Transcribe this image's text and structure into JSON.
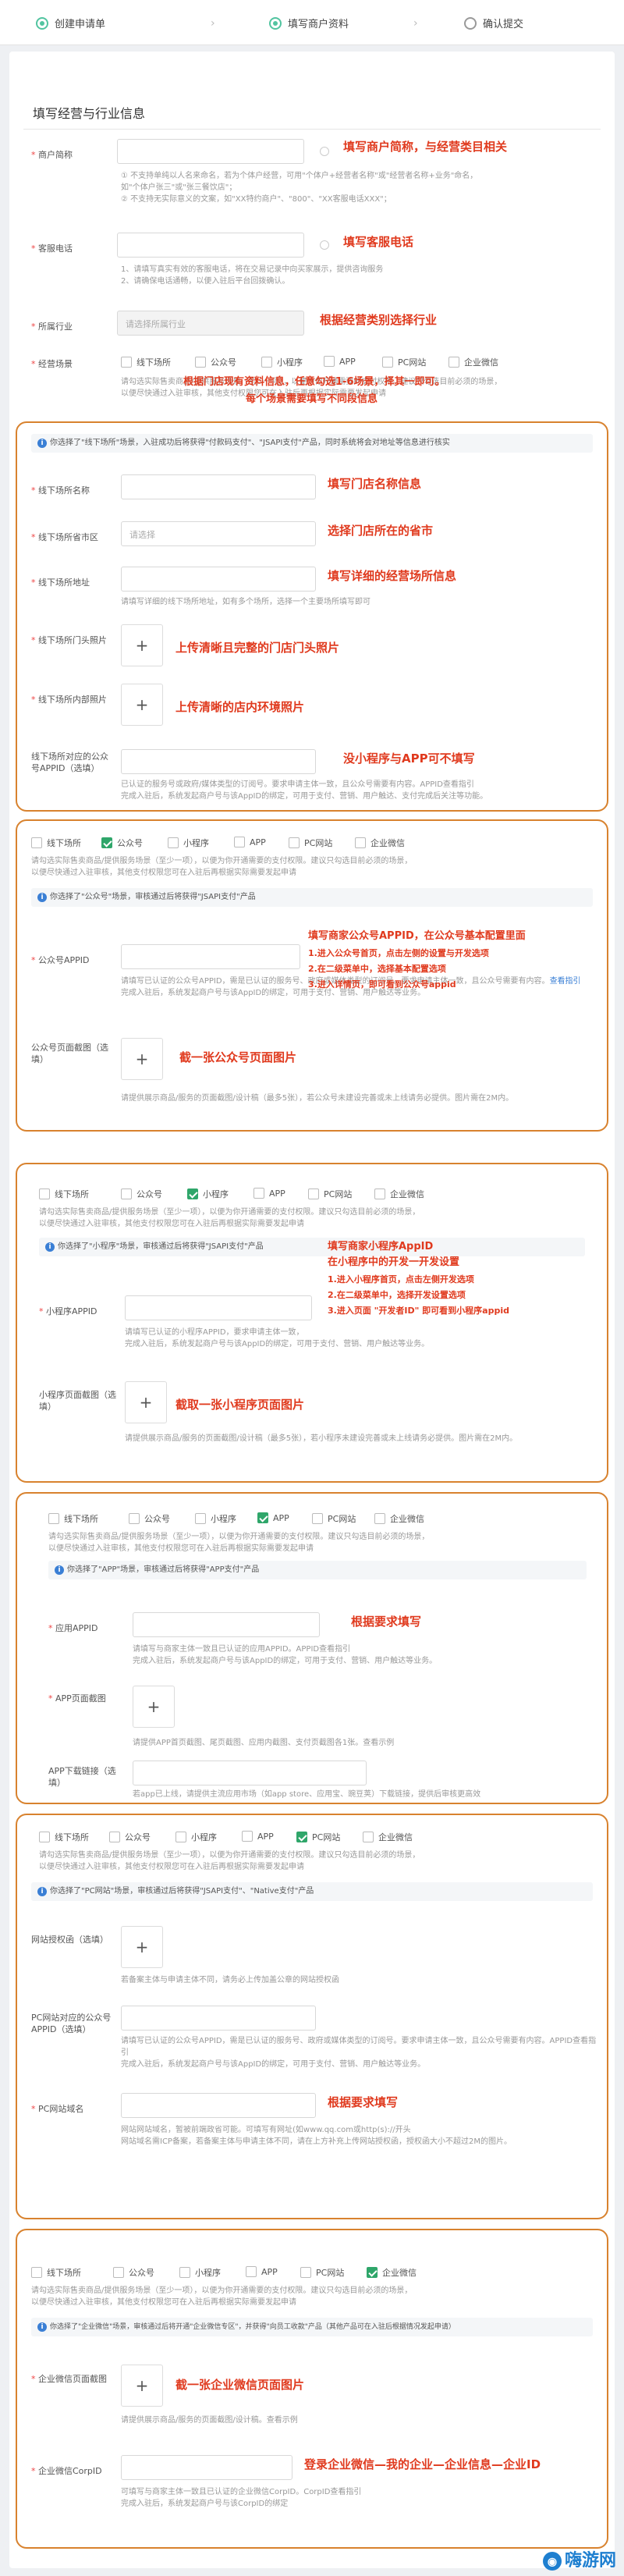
{
  "steps": [
    {
      "label": "创建申请单"
    },
    {
      "label": "填写商户资料"
    },
    {
      "label": "确认提交"
    }
  ],
  "section_title": "填写经营与行业信息",
  "merchant_short_name": {
    "label": "商户简称",
    "annotation": "填写商户简称，与经营类目相关",
    "hint1": "① 不支持单纯以人名来命名，若为个体户经营，可用\"个体户+经营者名称\"或\"经营者名称+业务\"命名，",
    "hint2": "如\"个体户张三\"或\"张三餐饮店\"；",
    "hint3": "② 不支持无实际意义的文案，如\"XX特约商户\"、\"800\"、\"XX客服电话XXX\"；"
  },
  "service_phone": {
    "label": "客服电话",
    "annotation": "填写客服电话",
    "hint1": "1、请填写真实有效的客服电话，将在交易记录中向买家展示，提供咨询服务",
    "hint2": "2、请确保电话通畅，以便入驻后平台回拨确认。"
  },
  "industry": {
    "label": "所属行业",
    "placeholder": "请选择所属行业",
    "annotation": "根据经营类别选择行业"
  },
  "business_scene": {
    "label": "经营场景",
    "options": [
      "线下场所",
      "公众号",
      "小程序",
      "APP",
      "PC网站",
      "企业微信"
    ],
    "hint1": "请勾选实际售卖商品/提供服务场景（至少一项），以便为你开通需要的支付权限。建议只勾选目前必须的场景，",
    "hint2": "以便尽快通过入驻审核，其他支付权限您可在入驻后再根据实际需要发起申请",
    "annotation1": "根据门店现有资料信息，任意勾选1-6场景，择其一即可。",
    "annotation2": "每个场景需要填写不同段信息"
  },
  "offline": {
    "info": "你选择了\"线下场所\"场景，入驻成功后将获得\"付款码支付\"、\"JSAPI支付\"产品，同时系统将会对地址等信息进行核实",
    "name_label": "线下场所名称",
    "name_annotation": "填写门店名称信息",
    "region_label": "线下场所省市区",
    "region_placeholder": "请选择",
    "region_annotation": "选择门店所在的省市",
    "address_label": "线下场所地址",
    "address_hint": "请填写详细的线下场所地址，如有多个场所，选择一个主要场所填写即可",
    "address_annotation": "填写详细的经营场所信息",
    "door_label": "线下场所门头照片",
    "door_annotation": "上传清晰且完整的门店门头照片",
    "inner_label": "线下场所内部照片",
    "inner_annotation": "上传清晰的店内环境照片",
    "appid_label": "线下场所对应的公众号APPID（选填）",
    "appid_annotation": "没小程序与APP可不填写",
    "appid_hint1": "已认证的服务号或政府/媒体类型的订阅号。要求申请主体一致，且公众号需要有内容。APPID查看指引",
    "appid_hint2": "完成入驻后，系统发起商户号与该AppID的绑定，可用于支付、营销、用户触达、支付完成后关注等功能。"
  },
  "mp": {
    "options": [
      "线下场所",
      "公众号",
      "小程序",
      "APP",
      "PC网站",
      "企业微信"
    ],
    "hint1": "请勾选实际售卖商品/提供服务场景（至少一项），以便为你开通需要的支付权限。建议只勾选目前必须的场景，",
    "hint2": "以便尽快通过入驻审核，其他支付权限您可在入驻后再根据实际需要发起申请",
    "info": "你选择了\"公众号\"场景，审核通过后将获得\"JSAPI支付\"产品",
    "appid_label": "公众号APPID",
    "appid_hint1": "请填写已认证的公众号APPID，需是已认证的服务号、政府或媒体类型的订阅号。要求申请主体一致，且公众号需要有内容。",
    "appid_hint_link": "查看指引",
    "appid_hint2": "完成入驻后，系统发起商户号与该AppID的绑定，可用于支付、营销、用户触达等业务。",
    "annotation_title": "填写商家公众号APPID，在公众号基本配置里面",
    "annotation_1": "1.进入公众号首页，点击左侧的设置与开发选项",
    "annotation_2": "2.在二级菜单中，选择基本配置选项",
    "annotation_3": "3.进入详情页，即可看到公众号appid",
    "screenshot_label": "公众号页面截图（选填）",
    "screenshot_annotation": "截一张公众号页面图片",
    "screenshot_hint": "请提供展示商品/服务的页面截图/设计稿（最多5张），若公众号未建设完善或未上线请务必提供。图片需在2M内。"
  },
  "mini": {
    "options": [
      "线下场所",
      "公众号",
      "小程序",
      "APP",
      "PC网站",
      "企业微信"
    ],
    "hint1": "请勾选实际售卖商品/提供服务场景（至少一项），以便为你开通需要的支付权限。建议只勾选目前必须的场景，",
    "hint2": "以便尽快通过入驻审核，其他支付权限您可在入驻后再根据实际需要发起申请",
    "info": "你选择了\"小程序\"场景，审核通过后将获得\"JSAPI支付\"产品",
    "appid_label": "小程序APPID",
    "appid_hint1": "请填写已认证的小程序APPID，要求申请主体一致，",
    "appid_hint2": "完成入驻后，系统发起商户号与该AppID的绑定，可用于支付、营销、用户触达等业务。",
    "annotation_title": "填写商家小程序AppID",
    "annotation_sub": "在小程序中的开发一开发设置",
    "annotation_1": "1.进入小程序首页，点击左侧开发选项",
    "annotation_2": "2.在二级菜单中，选择开发设置选项",
    "annotation_3": "3.进入页面 \"开发者ID\" 即可看到小程序appid",
    "screenshot_label": "小程序页面截图（选填）",
    "screenshot_annotation": "截取一张小程序页面图片",
    "screenshot_hint": "请提供展示商品/服务的页面截图/设计稿（最多5张），若小程序未建设完善或未上线请务必提供。图片需在2M内。"
  },
  "app": {
    "options": [
      "线下场所",
      "公众号",
      "小程序",
      "APP",
      "PC网站",
      "企业微信"
    ],
    "hint1": "请勾选实际售卖商品/提供服务场景（至少一项），以便为你开通需要的支付权限。建议只勾选目前必须的场景，",
    "hint2": "以便尽快通过入驻审核，其他支付权限您可在入驻后再根据实际需要发起申请",
    "info": "你选择了\"APP\"场景，审核通过后将获得\"APP支付\"产品",
    "appid_label": "应用APPID",
    "appid_annotation": "根据要求填写",
    "appid_hint1": "请填写与商家主体一致且已认证的应用APPID。APPID查看指引",
    "appid_hint2": "完成入驻后，系统发起商户号与该AppID的绑定，可用于支付、营销、用户触达等业务。",
    "screenshot_label": "APP页面截图",
    "screenshot_hint": "请提供APP首页截图、尾页截图、应用内截图、支付页截图各1张。查看示例",
    "download_label": "APP下载链接（选填）",
    "download_hint": "若app已上线，请提供主流应用市场（如app store、应用宝、豌豆荚）下载链接，提供后审核更高效"
  },
  "pc": {
    "options": [
      "线下场所",
      "公众号",
      "小程序",
      "APP",
      "PC网站",
      "企业微信"
    ],
    "hint1": "请勾选实际售卖商品/提供服务场景（至少一项），以便为你开通需要的支付权限。建议只勾选目前必须的场景，",
    "hint2": "以便尽快通过入驻审核，其他支付权限您可在入驻后再根据实际需要发起申请",
    "info": "你选择了\"PC网站\"场景，审核通过后将获得\"JSAPI支付\"、\"Native支付\"产品",
    "license_label": "网站授权函（选填）",
    "license_hint": "若备案主体与申请主体不同，请务必上传加盖公章的网站授权函",
    "appid_label": "PC网站对应的公众号APPID（选填）",
    "appid_hint1": "请填写已认证的公众号APPID，需是已认证的服务号、政府或媒体类型的订阅号。要求申请主体一致，且公众号需要有内容。APPID查看指引",
    "appid_hint2": "完成入驻后，系统发起商户号与该AppID的绑定，可用于支付、营销、用户触达等业务。",
    "domain_label": "PC网站域名",
    "domain_annotation": "根据要求填写",
    "domain_hint1": "网站网站域名，暂被前端政省可能。可填写有网址(如www.qq.com或http(s)://开头",
    "domain_hint2": "网站域名需ICP备案，若备案主体与申请主体不同，请在上方补充上传网站授权函，授权函大小不超过2M的图片。"
  },
  "wework": {
    "options": [
      "线下场所",
      "公众号",
      "小程序",
      "APP",
      "PC网站",
      "企业微信"
    ],
    "hint1": "请勾选实际售卖商品/提供服务场景（至少一项），以便为你开通需要的支付权限。建议只勾选目前必须的场景，",
    "hint2": "以便尽快通过入驻审核，其他支付权限您可在入驻后再根据实际需要发起申请",
    "info": "你选择了\"企业微信\"场景，审核通过后将开通\"企业微信专区\"，并获得\"向员工收款\"产品（其他产品可在入驻后根据情况发起申请）",
    "screenshot_label": "企业微信页面截图",
    "screenshot_annotation": "截一张企业微信页面图片",
    "screenshot_hint": "请提供展示商品/服务的页面截图/设计稿。查看示例",
    "corpid_label": "企业微信CorpID",
    "corpid_annotation": "登录企业微信—我的企业—企业信息—企业ID",
    "corpid_hint1": "可填写与商家主体一致且已认证的企业微信CorpID。CorpID查看指引",
    "corpid_hint2": "完成入驻后，系统发起商户号与该CorpID的绑定"
  },
  "watermark": {
    "text": "嗨游网"
  },
  "colors": {
    "accent": "#2fa66a",
    "annotation": "#e03a1e",
    "frame": "#d8822e",
    "link": "#3a7fd5"
  }
}
